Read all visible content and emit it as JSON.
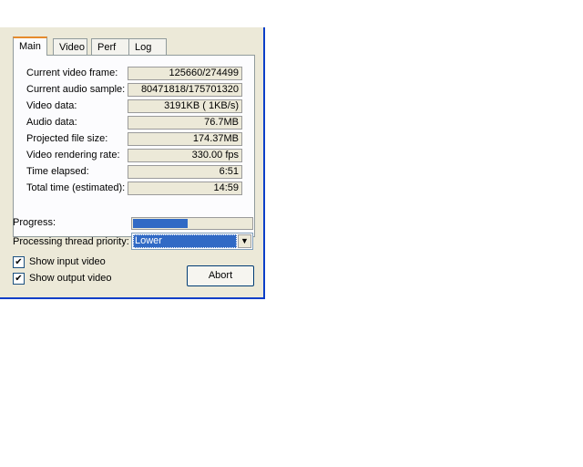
{
  "tabs": [
    "Main",
    "Video",
    "Perf",
    "Log"
  ],
  "stats": [
    {
      "label": "Current video frame:",
      "value": "125660/274499"
    },
    {
      "label": "Current audio sample:",
      "value": "80471818/175701320"
    },
    {
      "label": "Video data:",
      "value": "3191KB ( 1KB/s)"
    },
    {
      "label": "Audio data:",
      "value": "76.7MB"
    },
    {
      "label": "Projected file size:",
      "value": "174.37MB"
    },
    {
      "label": "Video rendering rate:",
      "value": "330.00 fps"
    },
    {
      "label": "Time elapsed:",
      "value": "6:51"
    },
    {
      "label": "Total time (estimated):",
      "value": "14:59"
    }
  ],
  "progress": {
    "label": "Progress:",
    "fraction": 0.46
  },
  "priority": {
    "label": "Processing thread priority:",
    "value": "Lower"
  },
  "show_input": {
    "label": "Show input video",
    "checked": true
  },
  "show_output": {
    "label": "Show output video",
    "checked": true
  },
  "abort_label": "Abort",
  "colors": {
    "accent": "#316ac5",
    "window_border": "#0a3ec8",
    "tab_highlight": "#e68b2c"
  }
}
